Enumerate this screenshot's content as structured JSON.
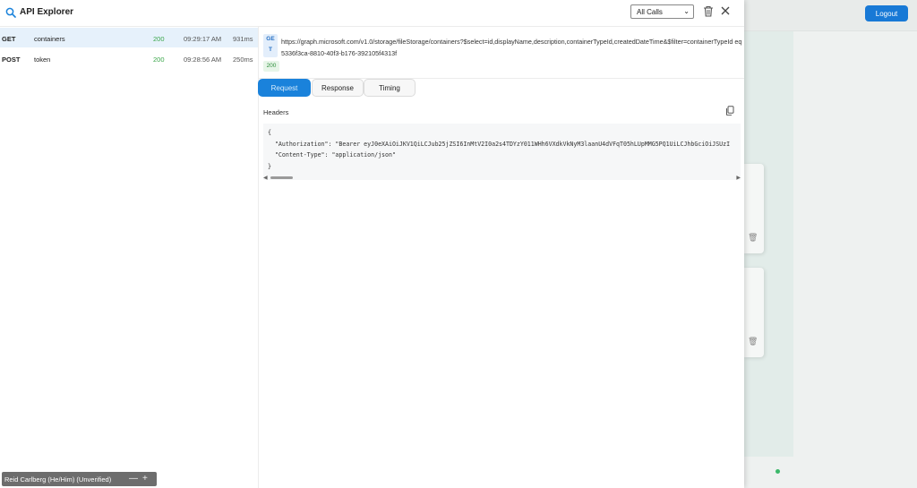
{
  "header": {
    "title": "API Explorer",
    "filter_value": "All Calls"
  },
  "calls": [
    {
      "method": "GET",
      "name": "containers",
      "status": "200",
      "time": "09:29:17 AM",
      "duration": "931ms"
    },
    {
      "method": "POST",
      "name": "token",
      "status": "200",
      "time": "09:28:56 AM",
      "duration": "250ms"
    }
  ],
  "detail": {
    "method": "GET",
    "url": "https://graph.microsoft.com/v1.0/storage/fileStorage/containers?$select=id,displayName,description,containerTypeId,createdDateTime&$filter=containerTypeId eq 5336f3ca-8810-40f3-b176-392105f4313f",
    "status": "200",
    "tabs": [
      "Request",
      "Response",
      "Timing"
    ],
    "section_label": "Headers",
    "code_lines": [
      "{",
      "  \"Authorization\": \"Bearer eyJ0eXAiOiJKV1QiLCJub25jZSI6InMtV2I0a2s4TDYzY011WHh6VXdkVkNyM3laanU4dVFqT05hLUpMMG5PQ1UiLCJhbGciOiJSUzI",
      "  \"Content-Type\": \"application/json\"",
      "}"
    ]
  },
  "background": {
    "logout_label": "Logout"
  },
  "user": {
    "label": "Reid Carlberg (He/Him) (Unverified)",
    "minimize": "—",
    "add": "+"
  },
  "colors": {
    "accent": "#1a82db",
    "status_ok": "#3aa64a",
    "selected_row": "#e6f1fb"
  }
}
